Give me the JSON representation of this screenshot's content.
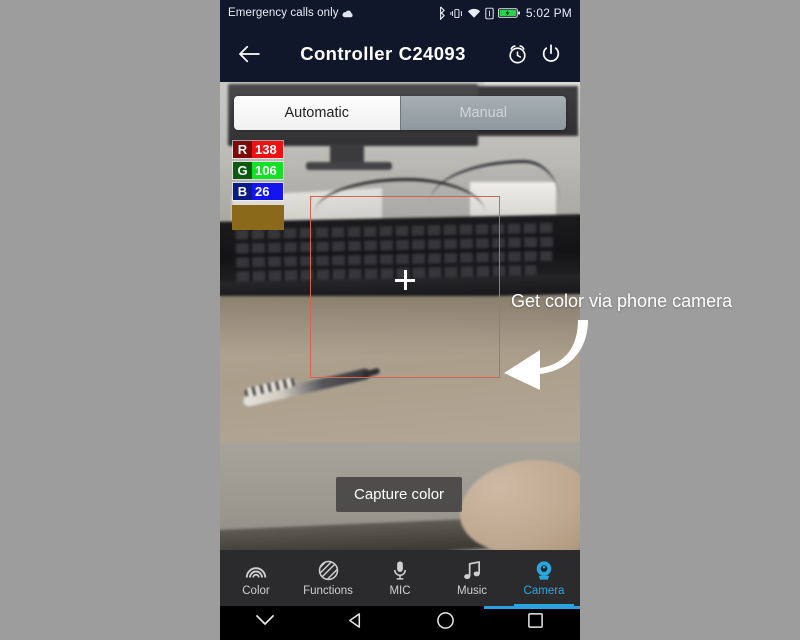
{
  "backdrop": {
    "color": "#9d9d9d"
  },
  "statusbar": {
    "carrier": "Emergency calls only",
    "time": "5:02 PM",
    "icons": [
      "cloud-icon",
      "bluetooth-icon",
      "vibrate-icon",
      "wifi-icon",
      "sim-card-icon",
      "battery-charging-icon"
    ]
  },
  "appbar": {
    "back_label": "back-arrow",
    "title": "Controller",
    "device_name": "C24093",
    "alarm_label": "alarm-clock",
    "power_label": "power"
  },
  "mode": {
    "automatic": "Automatic",
    "manual": "Manual",
    "selected": "Automatic"
  },
  "rgb": {
    "rows": [
      {
        "channel": "R",
        "value": "138"
      },
      {
        "channel": "G",
        "value": "106"
      },
      {
        "channel": "B",
        "value": "26"
      }
    ],
    "swatch_color": "#8a6a1a"
  },
  "preview": {
    "focus_box_color": "#d4634f",
    "crosshair": "crosshair-icon"
  },
  "capture": {
    "label": "Capture color"
  },
  "bottomnav": {
    "active": "Camera",
    "accent": "#29a8e0",
    "items": [
      {
        "label": "Color",
        "icon": "rainbow-icon"
      },
      {
        "label": "Functions",
        "icon": "striped-circle-icon"
      },
      {
        "label": "MIC",
        "icon": "microphone-icon"
      },
      {
        "label": "Music",
        "icon": "music-note-icon"
      },
      {
        "label": "Camera",
        "icon": "webcam-icon"
      }
    ]
  },
  "sysbar": {
    "buttons": [
      "chevron-down-icon",
      "back-triangle-icon",
      "home-circle-icon",
      "recents-square-icon"
    ]
  },
  "annotation": {
    "text": "Get color via phone camera",
    "arrow": "curved-arrow-left-icon",
    "color": "#ffffff"
  }
}
